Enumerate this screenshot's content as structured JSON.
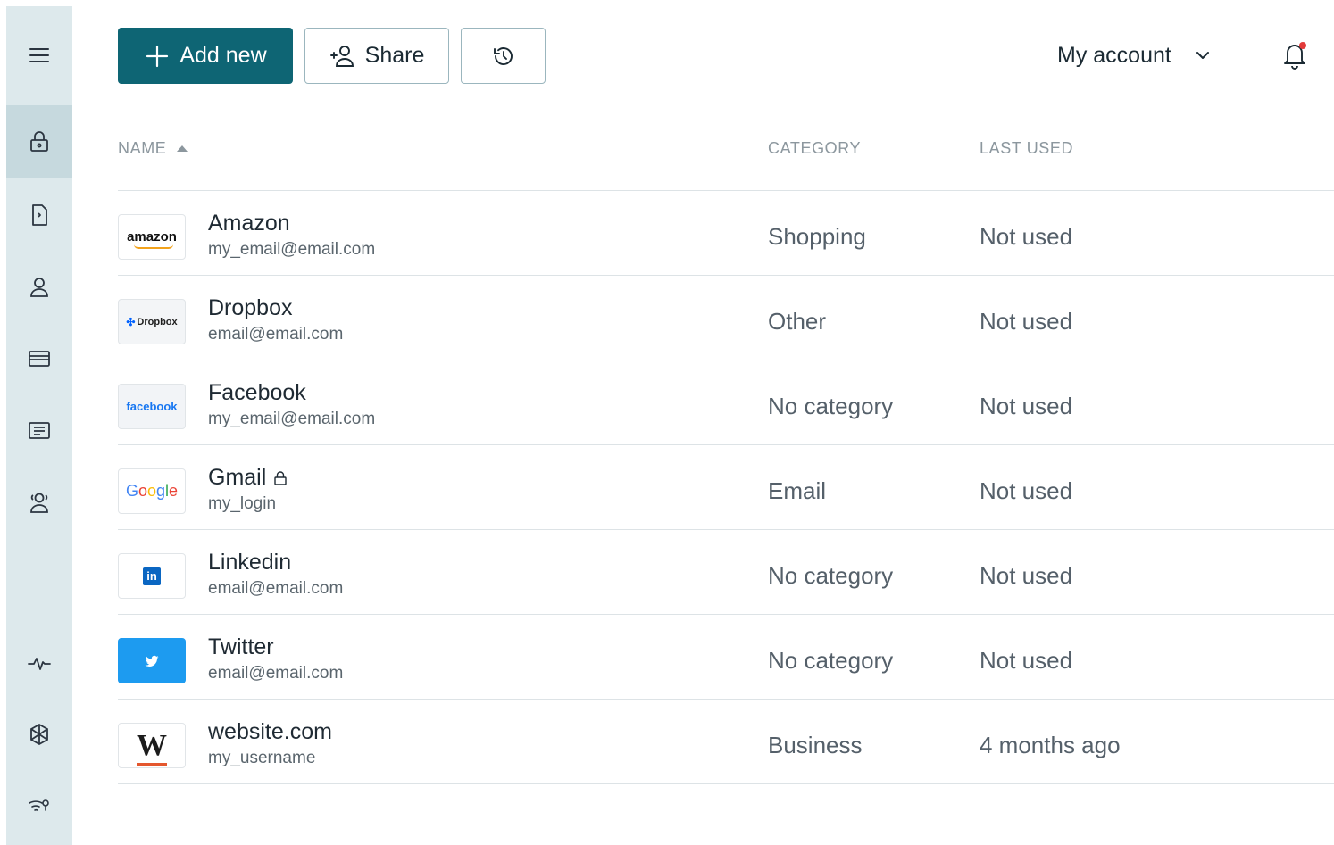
{
  "sidebar": {
    "items": [
      {
        "name": "menu-icon"
      },
      {
        "name": "lock-icon",
        "active": true
      },
      {
        "name": "document-icon"
      },
      {
        "name": "person-icon"
      },
      {
        "name": "card-icon"
      },
      {
        "name": "id-card-icon"
      },
      {
        "name": "contacts-icon"
      },
      {
        "name": "activity-icon"
      },
      {
        "name": "snowflake-icon"
      },
      {
        "name": "wifi-key-icon"
      }
    ]
  },
  "toolbar": {
    "add_label": "Add new",
    "share_label": "Share",
    "account_label": "My account"
  },
  "table": {
    "columns": {
      "name": "NAME",
      "category": "CATEGORY",
      "last_used": "LAST USED"
    },
    "rows": [
      {
        "name": "Amazon",
        "login": "my_email@email.com",
        "category": "Shopping",
        "last_used": "Not used",
        "logo_text": "amazon"
      },
      {
        "name": "Dropbox",
        "login": "email@email.com",
        "category": "Other",
        "last_used": "Not used",
        "logo_text": "Dropbox"
      },
      {
        "name": "Facebook",
        "login": "my_email@email.com",
        "category": "No category",
        "last_used": "Not used",
        "logo_text": "facebook"
      },
      {
        "name": "Gmail",
        "login": "my_login",
        "category": "Email",
        "last_used": "Not used",
        "logo_text": "Google",
        "locked": true
      },
      {
        "name": "Linkedin",
        "login": "email@email.com",
        "category": "No category",
        "last_used": "Not used",
        "logo_text": "in"
      },
      {
        "name": "Twitter",
        "login": "email@email.com",
        "category": "No category",
        "last_used": "Not used"
      },
      {
        "name": "website.com",
        "login": "my_username",
        "category": "Business",
        "last_used": "4 months ago",
        "logo_text": "W"
      }
    ]
  },
  "colors": {
    "primary": "#0e6574",
    "sidebar_bg": "#dde9ec",
    "sidebar_active": "#c6d9de",
    "notification_dot": "#e23a3a"
  }
}
